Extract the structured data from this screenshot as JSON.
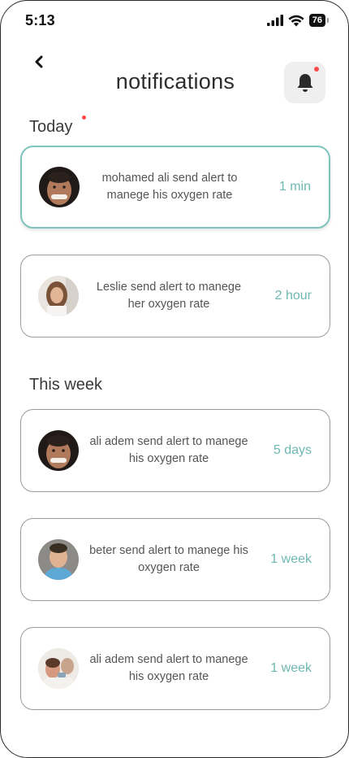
{
  "status_bar": {
    "time": "5:13",
    "battery": "76"
  },
  "header": {
    "title": "notifications"
  },
  "sections": {
    "today": "Today",
    "this_week": "This week"
  },
  "notifications": [
    {
      "message": "mohamed ali send alert to manege his oxygen rate",
      "time": "1 min"
    },
    {
      "message": "Leslie send alert to manege her oxygen rate",
      "time": "2 hour"
    },
    {
      "message": "ali adem send alert to manege his oxygen rate",
      "time": "5 days"
    },
    {
      "message": "beter send alert to manege his oxygen rate",
      "time": "1 week"
    },
    {
      "message": "ali adem send alert to manege his oxygen rate",
      "time": "1 week"
    }
  ],
  "colors": {
    "accent": "#6fb8b3",
    "active_border": "#7fc3be",
    "unread_dot": "#ff4a4a",
    "bell_bg": "#efefef"
  },
  "icons": {
    "back": "chevron-left-icon",
    "bell": "bell-icon",
    "signal": "signal-icon",
    "wifi": "wifi-icon",
    "battery": "battery-icon"
  }
}
